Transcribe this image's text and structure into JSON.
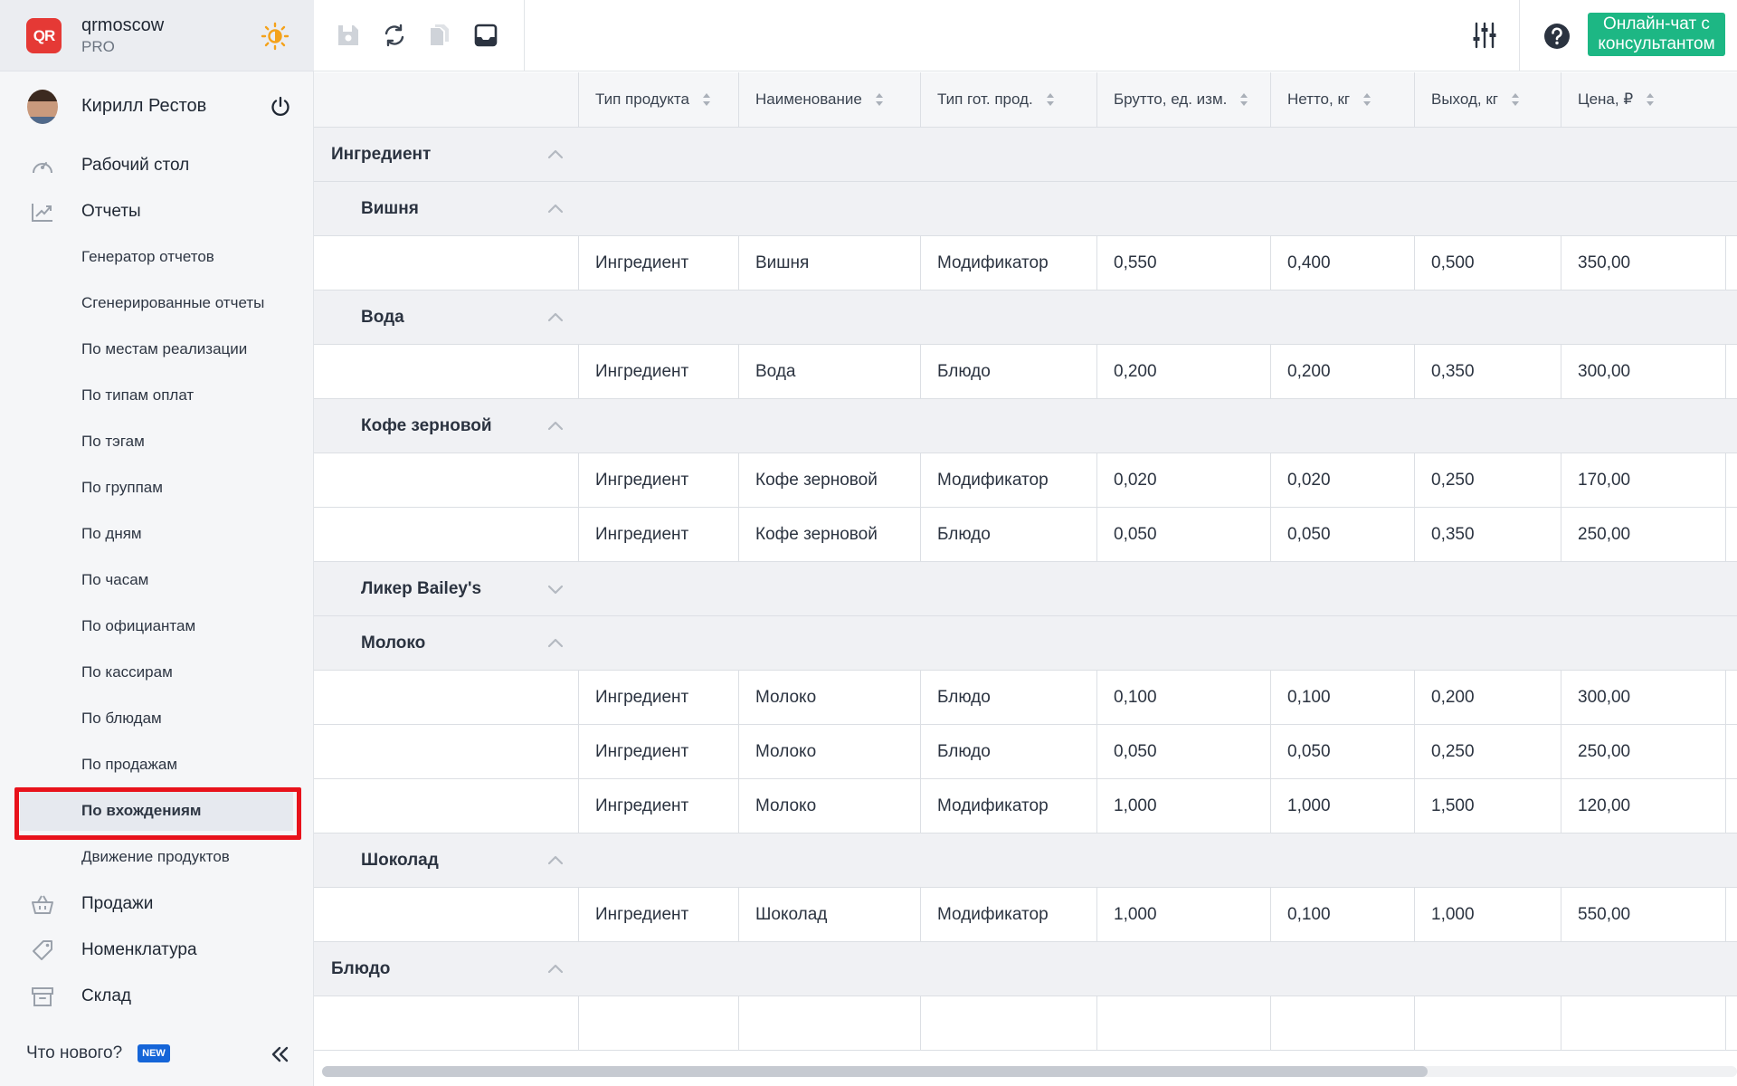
{
  "brand": {
    "logo_text": "QR",
    "name": "qrmoscow",
    "plan": "PRO"
  },
  "user": {
    "name": "Кирилл Рестов"
  },
  "nav": {
    "main_top": [
      {
        "label": "Рабочий стол",
        "icon": "dashboard-icon"
      },
      {
        "label": "Отчеты",
        "icon": "chart-icon"
      }
    ],
    "reports_sub": [
      "Генератор отчетов",
      "Сгенерированные отчеты",
      "По местам реализации",
      "По типам оплат",
      "По тэгам",
      "По группам",
      "По дням",
      "По часам",
      "По официантам",
      "По кассирам",
      "По блюдам",
      "По продажам",
      "По вхождениям",
      "Движение продуктов"
    ],
    "active_sub": "По вхождениям",
    "main_bottom": [
      {
        "label": "Продажи",
        "icon": "basket-icon"
      },
      {
        "label": "Номенклатура",
        "icon": "tag-icon"
      },
      {
        "label": "Склад",
        "icon": "archive-icon"
      }
    ]
  },
  "footer": {
    "whats_new": "Что нового?",
    "badge": "NEW"
  },
  "toolbar": {
    "chat_label": "Онлайн-чат с консультантом"
  },
  "colors": {
    "accent_green": "#1db784",
    "brand_red": "#e53935",
    "badge_blue": "#1565d8",
    "highlight_red": "#e8121b"
  },
  "table": {
    "columns": [
      "Тип продукта",
      "Наименование",
      "Тип гот. прод.",
      "Брутто, ед. изм.",
      "Нетто, кг",
      "Выход, кг",
      "Цена, ₽"
    ],
    "rows": [
      {
        "kind": "group",
        "level": 1,
        "label": "Ингредиент",
        "expanded": true
      },
      {
        "kind": "group",
        "level": 2,
        "label": "Вишня",
        "expanded": true
      },
      {
        "kind": "data",
        "cells": [
          "Ингредиент",
          "Вишня",
          "Модификатор",
          "0,550",
          "0,400",
          "0,500",
          "350,00"
        ]
      },
      {
        "kind": "group",
        "level": 2,
        "label": "Вода",
        "expanded": true
      },
      {
        "kind": "data",
        "cells": [
          "Ингредиент",
          "Вода",
          "Блюдо",
          "0,200",
          "0,200",
          "0,350",
          "300,00"
        ]
      },
      {
        "kind": "group",
        "level": 2,
        "label": "Кофе зерновой",
        "expanded": true
      },
      {
        "kind": "data",
        "cells": [
          "Ингредиент",
          "Кофе зерновой",
          "Модификатор",
          "0,020",
          "0,020",
          "0,250",
          "170,00"
        ]
      },
      {
        "kind": "data",
        "cells": [
          "Ингредиент",
          "Кофе зерновой",
          "Блюдо",
          "0,050",
          "0,050",
          "0,350",
          "250,00"
        ]
      },
      {
        "kind": "group",
        "level": 2,
        "label": "Ликер Bailey's",
        "expanded": false
      },
      {
        "kind": "group",
        "level": 2,
        "label": "Молоко",
        "expanded": true
      },
      {
        "kind": "data",
        "cells": [
          "Ингредиент",
          "Молоко",
          "Блюдо",
          "0,100",
          "0,100",
          "0,200",
          "300,00"
        ]
      },
      {
        "kind": "data",
        "cells": [
          "Ингредиент",
          "Молоко",
          "Блюдо",
          "0,050",
          "0,050",
          "0,250",
          "250,00"
        ]
      },
      {
        "kind": "data",
        "cells": [
          "Ингредиент",
          "Молоко",
          "Модификатор",
          "1,000",
          "1,000",
          "1,500",
          "120,00"
        ]
      },
      {
        "kind": "group",
        "level": 2,
        "label": "Шоколад",
        "expanded": true
      },
      {
        "kind": "data",
        "cells": [
          "Ингредиент",
          "Шоколад",
          "Модификатор",
          "1,000",
          "0,100",
          "1,000",
          "550,00"
        ]
      },
      {
        "kind": "group",
        "level": 1,
        "label": "Блюдо",
        "expanded": true
      },
      {
        "kind": "data",
        "cells": [
          "",
          "",
          "",
          "",
          "",
          "",
          ""
        ]
      }
    ]
  }
}
